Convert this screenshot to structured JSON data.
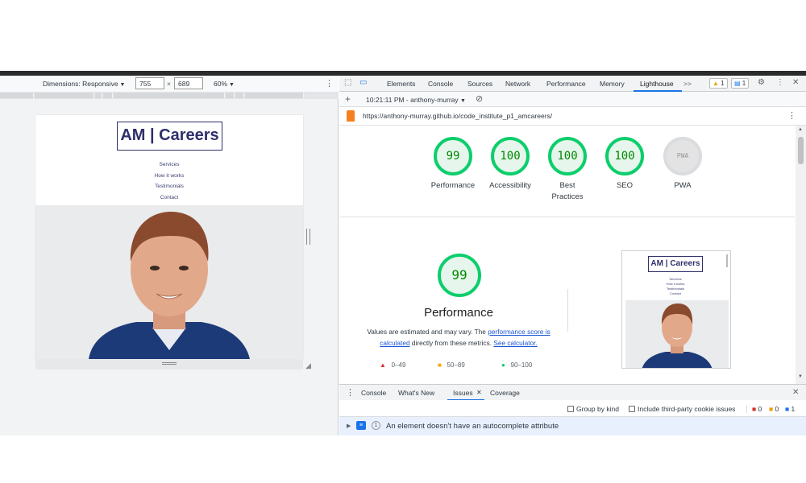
{
  "device_toolbar": {
    "dimensions_label": "Dimensions: Responsive",
    "width_value": "755",
    "times": "×",
    "height_value": "689",
    "zoom": "60%"
  },
  "site": {
    "logo": "AM | Careers",
    "nav": [
      "Services",
      "How it works",
      "Testimonials",
      "Contact"
    ]
  },
  "devtools": {
    "tabs": [
      "Elements",
      "Console",
      "Sources",
      "Network",
      "Performance",
      "Memory",
      "Lighthouse"
    ],
    "active_tab": "Lighthouse",
    "more_tabs": ">>",
    "warnings_count": "1",
    "messages_count": "1",
    "report_label": "10:21:11 PM - anthony-murray",
    "url": "https://anthony-murray.github.io/code_institute_p1_amcareers/"
  },
  "scores": [
    {
      "value": "99",
      "label": "Performance"
    },
    {
      "value": "100",
      "label": "Accessibility"
    },
    {
      "value": "100",
      "label": "Best Practices"
    },
    {
      "value": "100",
      "label": "SEO"
    },
    {
      "value": "PWA",
      "label": "PWA"
    }
  ],
  "performance": {
    "score": "99",
    "title": "Performance",
    "desc_pre": "Values are estimated and may vary. The ",
    "link1": "performance score is calculated",
    "desc_mid": " directly from these metrics. ",
    "link2": "See calculator.",
    "legend": [
      "0–49",
      "50–89",
      "90–100"
    ]
  },
  "thumbnail": {
    "logo": "AM | Careers",
    "nav": [
      "Services",
      "How it works",
      "Testimonials",
      "Contact"
    ]
  },
  "drawer": {
    "tabs": [
      "Console",
      "What's New",
      "Issues",
      "Coverage"
    ],
    "group_by_kind": "Group by kind",
    "third_party": "Include third-party cookie issues",
    "count_errors": "0",
    "count_warnings": "0",
    "count_info": "1",
    "issue_count": "1",
    "issue_text": "An element doesn't have an autocomplete attribute"
  },
  "colors": {
    "pass_green": "#0cce6b",
    "link_blue": "#1a55d4",
    "brand_navy": "#2f2f6b"
  }
}
